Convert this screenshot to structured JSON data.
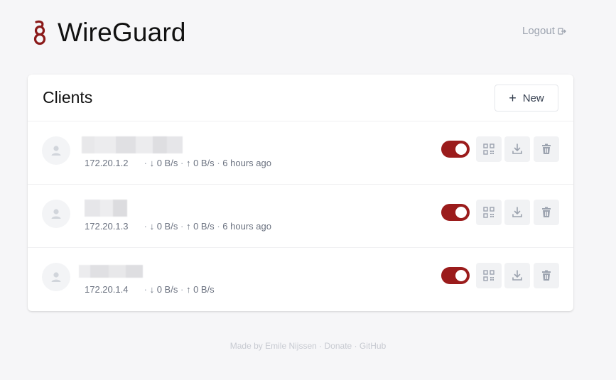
{
  "app": {
    "title": "WireGuard",
    "logout_label": "Logout"
  },
  "colors": {
    "accent": "#9b1c1c",
    "logo": "#8b1a1a"
  },
  "card": {
    "title": "Clients",
    "new_label": "New"
  },
  "clients": [
    {
      "ip": "172.20.1.2",
      "down": "0 B/s",
      "up": "0 B/s",
      "last_seen": "6 hours ago",
      "enabled": true
    },
    {
      "ip": "172.20.1.3",
      "down": "0 B/s",
      "up": "0 B/s",
      "last_seen": "6 hours ago",
      "enabled": true
    },
    {
      "ip": "172.20.1.4",
      "down": "0 B/s",
      "up": "0 B/s",
      "last_seen": "",
      "enabled": true
    }
  ],
  "footer": {
    "prefix": "Made by",
    "author": "Emile Nijssen",
    "dot": "·",
    "donate": "Donate",
    "github": "GitHub"
  }
}
